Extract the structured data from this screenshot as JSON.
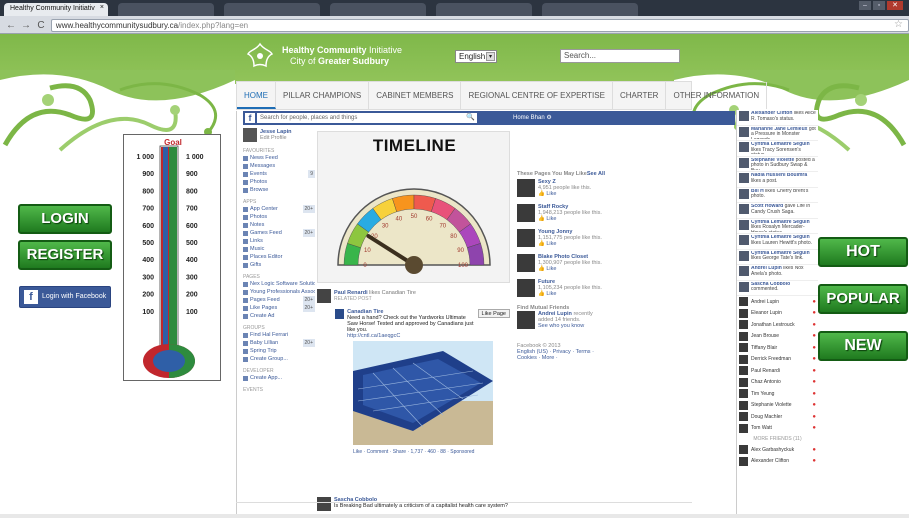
{
  "browser": {
    "tabs": [
      {
        "label": "Healthy Community Initiativ",
        "active": true
      },
      {
        "label": "",
        "active": false
      },
      {
        "label": "",
        "active": false
      },
      {
        "label": "",
        "active": false
      },
      {
        "label": "",
        "active": false
      },
      {
        "label": "",
        "active": false
      }
    ],
    "tab_close": "×",
    "nav_back": "←",
    "nav_forward": "→",
    "nav_reload": "C",
    "url_domain": "www.healthycommunitysudbury.ca",
    "url_path": "/index.php?lang=en",
    "star": "☆",
    "win_min": "–",
    "win_max": "▫",
    "win_close": "✕"
  },
  "header": {
    "title_line1_bold": "Healthy Community",
    "title_line1_rest": " Initiative",
    "title_line2_pre": "City of ",
    "title_line2_bold": "Greater Sudbury",
    "language": "English",
    "lang_arrow": "▾",
    "search_placeholder": "Search..."
  },
  "nav": {
    "items": [
      "HOME",
      "PILLAR CHAMPIONS",
      "CABINET MEMBERS",
      "REGIONAL CENTRE OF EXPERTISE",
      "CHARTER",
      "OTHER INFORMATION"
    ]
  },
  "left": {
    "login": "LOGIN",
    "register": "REGISTER",
    "facebook": "Login with Facebook",
    "facebook_icon": "f"
  },
  "right": {
    "hot": "HOT",
    "popular": "POPULAR",
    "new": "NEW"
  },
  "thermometer": {
    "goal_label": "Goal",
    "ticks": [
      "1 000",
      "900",
      "800",
      "700",
      "600",
      "500",
      "400",
      "300",
      "200",
      "100"
    ],
    "fill_fraction": 0.22,
    "colors": {
      "red": "#c1272d",
      "green": "#2e8b3e",
      "blue": "#2f5fa7"
    }
  },
  "facebook": {
    "logo": "f",
    "search_placeholder": "Search for people, places and things",
    "search_icon": "🔍",
    "top_right": "Home  Bhan  ⚙",
    "profile_name": "Jesse Lapin",
    "profile_sub": "Edit Profile",
    "sections": [
      {
        "title": "FAVOURITES",
        "items": [
          [
            "News Feed",
            ""
          ],
          [
            "Messages",
            ""
          ],
          [
            "Events",
            "9"
          ],
          [
            "Photos",
            ""
          ],
          [
            "Browse",
            ""
          ]
        ]
      },
      {
        "title": "APPS",
        "items": [
          [
            "App Center",
            "20+"
          ],
          [
            "Photos",
            ""
          ],
          [
            "Notes",
            ""
          ],
          [
            "Games Feed",
            "20+"
          ],
          [
            "Links",
            ""
          ],
          [
            "Music",
            ""
          ],
          [
            "Places Editor",
            ""
          ],
          [
            "Gifts",
            ""
          ]
        ]
      },
      {
        "title": "PAGES",
        "items": [
          [
            "Nex Logic Software Solutions",
            ""
          ],
          [
            "Young Professionals Assoc.",
            ""
          ],
          [
            "Pages Feed",
            "20+"
          ],
          [
            "Like Pages",
            "20+"
          ],
          [
            "Create Ad",
            ""
          ]
        ]
      },
      {
        "title": "GROUPS",
        "items": [
          [
            "Find Hal Ferrari",
            ""
          ],
          [
            "Baby Lillian",
            "20+"
          ],
          [
            "Spring Trip",
            ""
          ],
          [
            "Create Group...",
            ""
          ]
        ]
      },
      {
        "title": "DEVELOPER",
        "items": [
          [
            "Create App...",
            ""
          ]
        ]
      },
      {
        "title": "EVENTS",
        "items": []
      }
    ],
    "timeline": {
      "title": "TIMELINE",
      "gauge_labels": [
        "0",
        "10",
        "20",
        "30",
        "40",
        "50",
        "60",
        "70",
        "80",
        "90",
        "100"
      ],
      "gauge_value": 18
    },
    "post1": {
      "author": "Paul Renardi",
      "author_suffix": "likes Canadian Tire",
      "related": "RELATED POST",
      "page": "Canadian Tire",
      "like_page": "Like Page",
      "text": "Need a hand? Check out the Yardworks Ultimate Saw Horse! Tested and approved by Canadians just like you.",
      "link": "http://cntl.ca/1aeqgcC",
      "actions": "Like · Comment · Share · 1,737 · 460 · 88 · Sponsored"
    },
    "post2": {
      "author": "Sascha Cobbolo",
      "text": "Is Breaking Bad ultimately a criticism of a capitalist health care system?"
    },
    "pages_header": "These Pages You May Like",
    "pages_see_all": "See All",
    "pages": [
      {
        "name": "Sexy Z",
        "sub": "4,951 people like this.",
        "like": "Like"
      },
      {
        "name": "Staff Rocky",
        "sub": "1,948,213 people like this.",
        "like": "Like"
      },
      {
        "name": "Young Jonny",
        "sub": "1,151,775 people like this.",
        "like": "Like"
      },
      {
        "name": "Blake Photo Closet",
        "sub": "1,300,907 people like this.",
        "like": "Like"
      },
      {
        "name": "Future",
        "sub": "1,105,234 people like this.",
        "like": "Like"
      }
    ],
    "friends_header": "Find Mutual Friends",
    "friend": {
      "name": "Andrei Lupin",
      "sub": "recently added 14 friends.",
      "link": "See who you know"
    },
    "footer1": "Facebook © 2013",
    "footer2": "English (US) · Privacy · Terms · Cookies · More ·"
  },
  "ticker": {
    "items": [
      {
        "name": "Alexander Clifton",
        "text": "likes Alice R. Tomaso's status."
      },
      {
        "name": "Marianne Jane Lemieux",
        "text": "got a Pressure in Monster Legends."
      },
      {
        "name": "Cynthia Lemaitre Seguin",
        "text": "likes Tracy Sorensen's status."
      },
      {
        "name": "Stephanie Violette",
        "text": "posted a photo in Sudbury Swap & Buy."
      },
      {
        "name": "Nadia Husseni Boulmra",
        "text": "likes a post."
      },
      {
        "name": "Bill H",
        "text": "likes Cherry Brent's photo."
      },
      {
        "name": "Scott Howard",
        "text": "gave Life in Candy Crush Saga."
      },
      {
        "name": "Cynthia Lemaitre Seguin",
        "text": "likes Rosalyn Mercader-Howe's status."
      },
      {
        "name": "Cynthia Lemaitre Seguin",
        "text": "likes Lauren Hewitt's photo."
      },
      {
        "name": "Cynthia Lemaitre Seguin",
        "text": "likes George Tate's link."
      },
      {
        "name": "Andrei Lupin",
        "text": "likes Nox Anela's photo."
      },
      {
        "name": "Sascha Cobbolo",
        "text": "commented."
      }
    ],
    "chat": [
      {
        "name": "Andrei Lupin",
        "status": "●"
      },
      {
        "name": "Eleanor Lupin",
        "status": "●"
      },
      {
        "name": "Jonathan Lestrouck",
        "status": "●"
      },
      {
        "name": "Jean Brouse",
        "status": "●"
      },
      {
        "name": "Tiffany Blair",
        "status": "●"
      },
      {
        "name": "Derrick Freedman",
        "status": "●"
      },
      {
        "name": "Paul Renardi",
        "status": "●"
      },
      {
        "name": "Chaz Antonio",
        "status": "●"
      },
      {
        "name": "Tim Yeung",
        "status": "●"
      },
      {
        "name": "Stephanie Violette",
        "status": "●"
      },
      {
        "name": "Doug Machler",
        "status": "●"
      },
      {
        "name": "Tom Watt",
        "status": "●"
      }
    ],
    "more_header": "MORE FRIENDS (11)",
    "more": [
      {
        "name": "Alex Garbashyckuk",
        "status": "●"
      },
      {
        "name": "Alexander Clifton",
        "status": "●"
      }
    ]
  }
}
